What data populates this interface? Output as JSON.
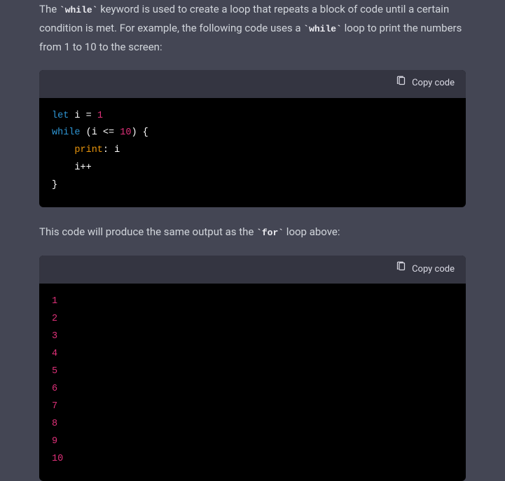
{
  "para1": {
    "t1": "The ",
    "code1": "`while`",
    "t2": " keyword is used to create a loop that repeats a block of code until a certain condition is met. For example, the following code uses a ",
    "code2": "`while`",
    "t3": " loop to print the numbers from 1 to 10 to the screen:"
  },
  "codeblock1": {
    "copy_label": "Copy code",
    "tokens": {
      "let": "let",
      "var_decl": " i = ",
      "one": "1",
      "while": "while",
      "cond_open": " (i <= ",
      "ten": "10",
      "cond_close": ") {",
      "indent": "    ",
      "print": "print",
      "print_rest": ": i",
      "inc": "i++",
      "close": "}"
    }
  },
  "para2": {
    "t1": "This code will produce the same output as the ",
    "code1": "`for`",
    "t2": " loop above:"
  },
  "codeblock2": {
    "copy_label": "Copy code",
    "lines": {
      "l1": "1",
      "l2": "2",
      "l3": "3",
      "l4": "4",
      "l5": "5",
      "l6": "6",
      "l7": "7",
      "l8": "8",
      "l9": "9",
      "l10": "10"
    }
  }
}
